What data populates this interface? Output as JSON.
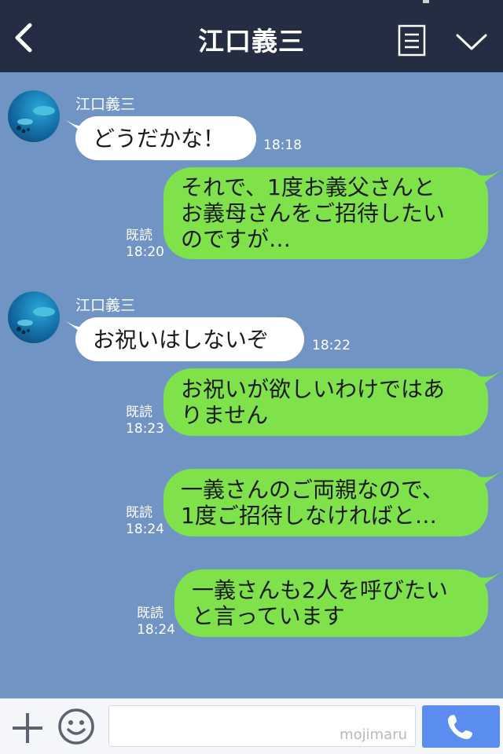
{
  "header": {
    "title": "江口義三",
    "back_icon": "chevron-left-icon",
    "menu_icon": "note-icon",
    "expand_icon": "chevron-down-icon"
  },
  "messages": [
    {
      "direction": "incoming",
      "sender": "江口義三",
      "text": "どうだかな！",
      "time": "18:18"
    },
    {
      "direction": "outgoing",
      "read": "既読",
      "text": "それで、1度お義父さんと\nお義母さんをご招待したい\nのですが…",
      "time": "18:20"
    },
    {
      "direction": "incoming",
      "sender": "江口義三",
      "text": "お祝いはしないぞ",
      "time": "18:22"
    },
    {
      "direction": "outgoing",
      "read": "既読",
      "text": "お祝いが欲しいわけではあ\nりません",
      "time": "18:23"
    },
    {
      "direction": "outgoing",
      "read": "既読",
      "text": "一義さんのご両親なので、\n1度ご招待しなければと…",
      "time": "18:24"
    },
    {
      "direction": "outgoing",
      "read": "既読",
      "text": "一義さんも2人を呼びたい\nと言っています",
      "time": "18:24"
    }
  ],
  "input_bar": {
    "plus_icon": "plus-icon",
    "emoji_icon": "smile-icon",
    "watermark": "mojimaru",
    "call_icon": "phone-icon"
  },
  "colors": {
    "header_bg": "#242d42",
    "chat_bg": "#7094c4",
    "outgoing_bubble": "#7fe24a",
    "incoming_bubble": "#ffffff",
    "call_button": "#5b8cf0"
  }
}
